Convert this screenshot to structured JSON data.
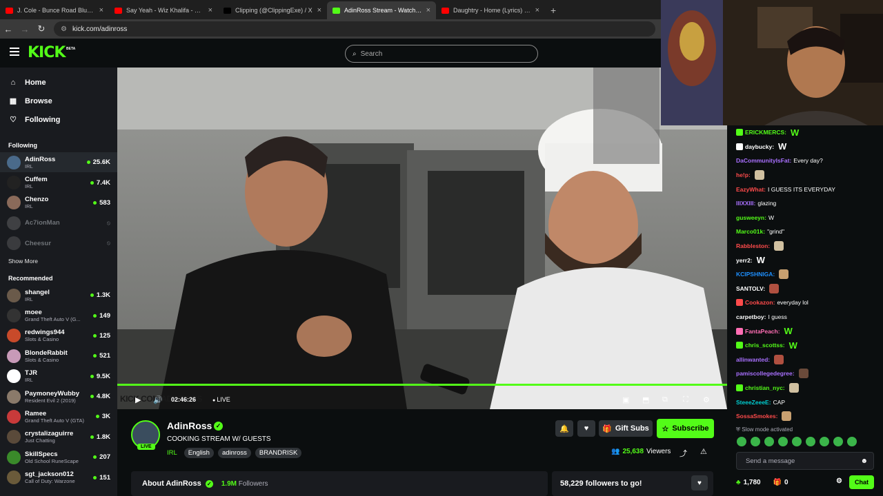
{
  "browser": {
    "tabs": [
      {
        "title": "J. Cole - Bunce Road Blues (Inst",
        "fav_color": "#ff0000"
      },
      {
        "title": "Say Yeah - Wiz Khalifa - YouTub",
        "fav_color": "#ff0000"
      },
      {
        "title": "Clipping (@ClippingExe) / X",
        "fav_color": "#000000"
      },
      {
        "title": "AdinRoss Stream - Watch Live o",
        "fav_color": "#53fc18"
      },
      {
        "title": "Daughtry - Home (Lyrics) - YouT",
        "fav_color": "#ff0000"
      }
    ],
    "active_tab": 3,
    "new_tab": "+",
    "url": "kick.com/adinross"
  },
  "header": {
    "logo": "KICK",
    "beta": "BETA",
    "search_placeholder": "Search"
  },
  "sidebar": {
    "nav": [
      {
        "label": "Home",
        "icon": "⌂"
      },
      {
        "label": "Browse",
        "icon": "▦"
      },
      {
        "label": "Following",
        "icon": "♡"
      }
    ],
    "following_title": "Following",
    "following": [
      {
        "name": "AdinRoss",
        "category": "IRL",
        "viewers": "25.6K",
        "color": "#4a6a8a",
        "live": true
      },
      {
        "name": "Cuffem",
        "category": "IRL",
        "viewers": "7.4K",
        "color": "#222222",
        "live": true
      },
      {
        "name": "Chenzo",
        "category": "IRL",
        "viewers": "583",
        "color": "#8a6a5a",
        "live": true
      },
      {
        "name": "Ac7ionMan",
        "category": "",
        "viewers": "",
        "color": "#888888",
        "live": false
      },
      {
        "name": "Cheesur",
        "category": "",
        "viewers": "",
        "color": "#777777",
        "live": false
      }
    ],
    "show_more": "Show More",
    "recommended_title": "Recommended",
    "recommended": [
      {
        "name": "shangel",
        "category": "IRL",
        "viewers": "1.3K",
        "color": "#6a5a4a"
      },
      {
        "name": "moee",
        "category": "Grand Theft Auto V (G...",
        "viewers": "149",
        "color": "#333333"
      },
      {
        "name": "redwings944",
        "category": "Slots & Casino",
        "viewers": "125",
        "color": "#c84a2a"
      },
      {
        "name": "BlondeRabbit",
        "category": "Slots & Casino",
        "viewers": "521",
        "color": "#c89ab8"
      },
      {
        "name": "TJR",
        "category": "IRL",
        "viewers": "9.5K",
        "color": "#ffffff"
      },
      {
        "name": "PaymoneyWubby",
        "category": "Resident Evil 2 (2019)",
        "viewers": "4.8K",
        "color": "#8a7a6a"
      },
      {
        "name": "Ramee",
        "category": "Grand Theft Auto V (GTA)",
        "viewers": "3K",
        "color": "#c83a3a"
      },
      {
        "name": "crystalizaguirre",
        "category": "Just Chatting",
        "viewers": "1.8K",
        "color": "#5a4a3a"
      },
      {
        "name": "SkillSpecs",
        "category": "Old School RuneScape",
        "viewers": "207",
        "color": "#3a8a2a"
      },
      {
        "name": "sgt_jackson012",
        "category": "Call of Duty: Warzone",
        "viewers": "151",
        "color": "#6a5a3a"
      }
    ]
  },
  "video": {
    "timecode": "02:46:26",
    "live_label": "LIVE",
    "watermark": "KICK.COM/ADINROSS",
    "progress": 1.0
  },
  "stream": {
    "channel": "AdinRoss",
    "live_pill": "LIVE",
    "title": "COOKING STREAM W/ GUESTS",
    "category": "IRL",
    "tags": [
      "English",
      "adinross",
      "BRANDRISK"
    ],
    "gift_label": "Gift Subs",
    "subscribe_label": "Subscribe",
    "viewers": "25,638",
    "viewers_label": "Viewers",
    "about": "About AdinRoss",
    "followers_count": "1.9M",
    "followers_label": "Followers",
    "goal": "58,229 followers to go!"
  },
  "chat": {
    "messages": [
      {
        "user": "ERICKMERCS:",
        "color": "#53fc18",
        "text": "",
        "emote": "W",
        "badge": true
      },
      {
        "user": "daybucky:",
        "color": "#ffffff",
        "text": "",
        "emote": "W",
        "badge": true
      },
      {
        "user": "DaCommunityIsFat:",
        "color": "#a970ff",
        "text": "Every day?",
        "emote": "",
        "badge": false
      },
      {
        "user": "he!p:",
        "color": "#ff4b4b",
        "text": "",
        "emote": "img",
        "badge": false
      },
      {
        "user": "EazyWhat:",
        "color": "#ff4b4b",
        "text": "I GUESS ITS EVERYDAY",
        "emote": "",
        "badge": false
      },
      {
        "user": "IIIXXIII:",
        "color": "#a970ff",
        "text": "glazing",
        "emote": "",
        "badge": false
      },
      {
        "user": "gusweeyn:",
        "color": "#53fc18",
        "text": "W",
        "emote": "",
        "badge": false
      },
      {
        "user": "Marco01k:",
        "color": "#53fc18",
        "text": "\"grind\"",
        "emote": "",
        "badge": false
      },
      {
        "user": "Rabbleston:",
        "color": "#ff4b4b",
        "text": "",
        "emote": "img",
        "badge": false
      },
      {
        "user": "yerr2:",
        "color": "#ffffff",
        "text": "",
        "emote": "W",
        "badge": false
      },
      {
        "user": "KCIPSHNIGA:",
        "color": "#1e90ff",
        "text": "",
        "emote": "img",
        "badge": false
      },
      {
        "user": "SANTOLV:",
        "color": "#ffffff",
        "text": "",
        "emote": "img",
        "badge": false
      },
      {
        "user": "Cookazon:",
        "color": "#ff4b4b",
        "text": "everyday lol",
        "emote": "",
        "badge": true
      },
      {
        "user": "carpetboy:",
        "color": "#ffffff",
        "text": "I guess",
        "emote": "",
        "badge": false
      },
      {
        "user": "FantaPeach:",
        "color": "#ff6eb4",
        "text": "",
        "emote": "W",
        "badge": true
      },
      {
        "user": "chris_scottss:",
        "color": "#53fc18",
        "text": "",
        "emote": "W",
        "badge": true
      },
      {
        "user": "allinwanted:",
        "color": "#a970ff",
        "text": "",
        "emote": "img",
        "badge": false
      },
      {
        "user": "pamiscollegedegree:",
        "color": "#a970ff",
        "text": "",
        "emote": "img",
        "badge": false
      },
      {
        "user": "christian_nyc:",
        "color": "#53fc18",
        "text": "",
        "emote": "img",
        "badge": true
      },
      {
        "user": "SteeeZeeeE:",
        "color": "#00ced1",
        "text": "CAP",
        "emote": "",
        "badge": false
      },
      {
        "user": "SossaSmokes:",
        "color": "#ff4b4b",
        "text": "",
        "emote": "img",
        "badge": false
      }
    ],
    "slow_mode": "Slow mode activated",
    "placeholder": "Send a message",
    "points": "1,780",
    "gifts": "0",
    "chat_button": "Chat"
  }
}
